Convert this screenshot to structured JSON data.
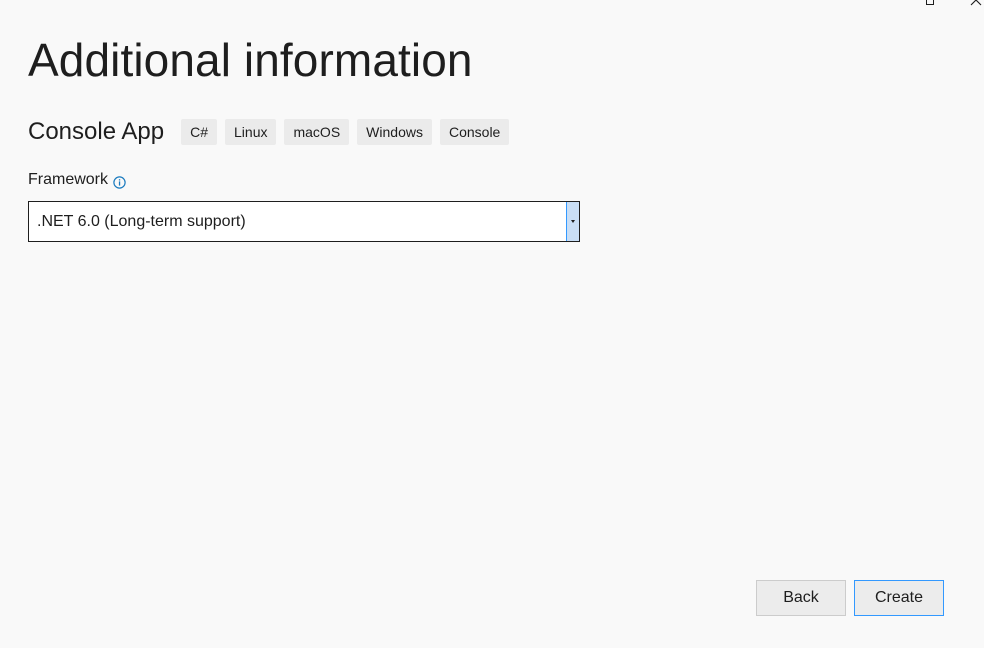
{
  "window": {
    "controls": [
      "maximize-icon",
      "close-icon"
    ]
  },
  "page": {
    "title": "Additional information"
  },
  "project": {
    "name": "Console App",
    "tags": [
      "C#",
      "Linux",
      "macOS",
      "Windows",
      "Console"
    ]
  },
  "framework": {
    "label": "Framework",
    "info_icon": "info-icon",
    "selected": ".NET 6.0 (Long-term support)"
  },
  "footer": {
    "back_label": "Back",
    "create_label": "Create"
  },
  "colors": {
    "background": "#f9f9f9",
    "tag_background": "#ebebeb",
    "accent": "#3399ff",
    "info_icon": "#1b7bbf",
    "dropdown_button": "#c9def5"
  }
}
